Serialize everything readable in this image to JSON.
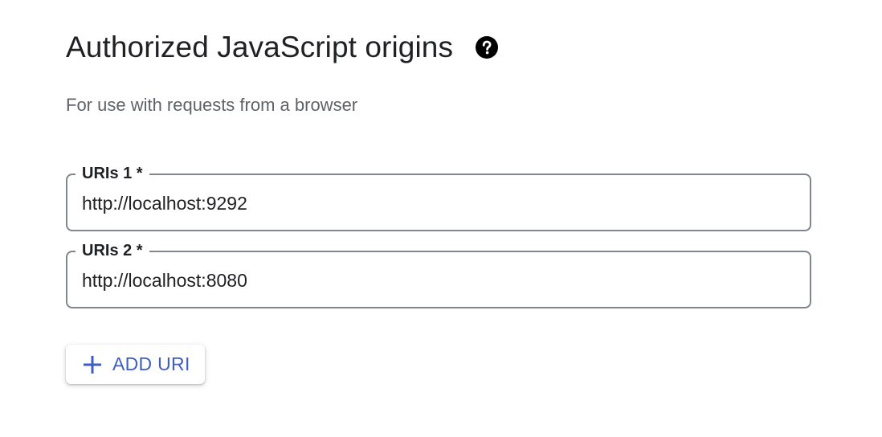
{
  "section": {
    "title": "Authorized JavaScript origins",
    "subtitle": "For use with requests from a browser",
    "help_icon": "help-circle-icon"
  },
  "uris": [
    {
      "label": "URIs 1 *",
      "value": "http://localhost:9292"
    },
    {
      "label": "URIs 2 *",
      "value": "http://localhost:8080"
    }
  ],
  "add_button": {
    "label": "ADD URI",
    "icon": "plus-icon"
  },
  "colors": {
    "accent": "#3f5ec5",
    "title": "#202124",
    "subtitle": "#5f6368",
    "border": "#80868b"
  }
}
